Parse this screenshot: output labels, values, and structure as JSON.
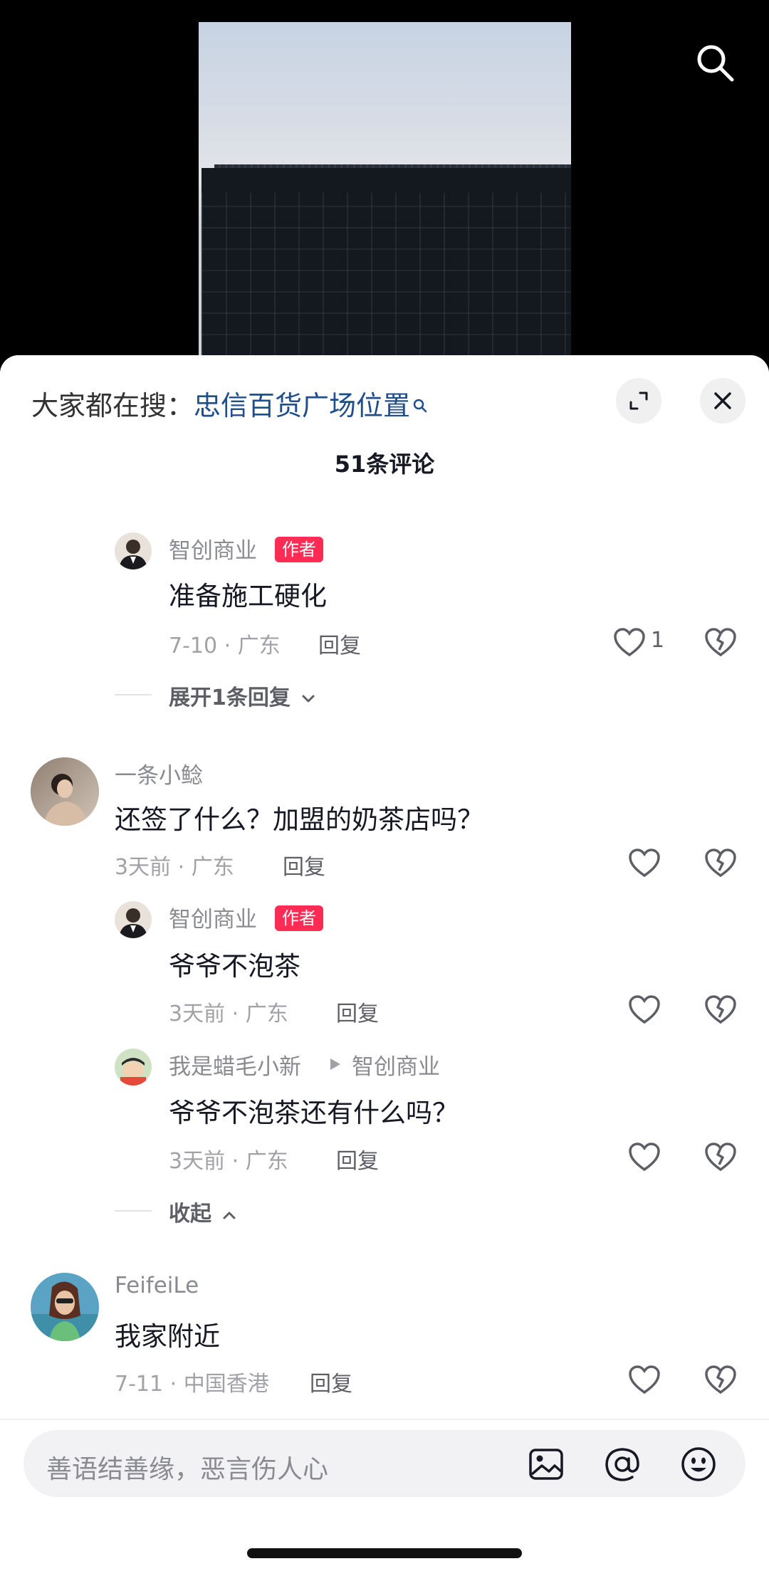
{
  "video": {
    "search_icon": "search-icon"
  },
  "sheet": {
    "trending_prefix": "大家都在搜：",
    "trending_query": "忠信百货广场位置",
    "comment_count": "51条评论",
    "expand_icon": "expand-icon",
    "close_icon": "close-icon"
  },
  "comments": [
    {
      "name": "智创商业",
      "badge": "作者",
      "text": "准备施工硬化",
      "meta": "7-10 · 广东",
      "reply": "回复",
      "likes": "1"
    },
    {
      "toggle": "展开1条回复"
    },
    {
      "name": "一条小鲶",
      "text": "还签了什么？加盟的奶茶店吗？",
      "meta": "3天前 · 广东",
      "reply": "回复"
    },
    {
      "name": "智创商业",
      "badge": "作者",
      "text": "爷爷不泡茶",
      "meta": "3天前 · 广东",
      "reply": "回复"
    },
    {
      "name": "我是蜡毛小新",
      "reply_to": "智创商业",
      "text": "爷爷不泡茶还有什么吗？",
      "meta": "3天前 · 广东",
      "reply": "回复"
    },
    {
      "toggle": "收起"
    },
    {
      "name": "FeifeiLe",
      "text": "我家附近",
      "meta": "7-11 · 中国香港",
      "reply": "回复"
    }
  ],
  "input": {
    "placeholder": "善语结善缘，恶言伤人心",
    "icons": [
      "image-icon",
      "at-icon",
      "emoji-icon"
    ]
  },
  "colors": {
    "badge": "#fe2c55",
    "link": "#1f4e8c"
  }
}
